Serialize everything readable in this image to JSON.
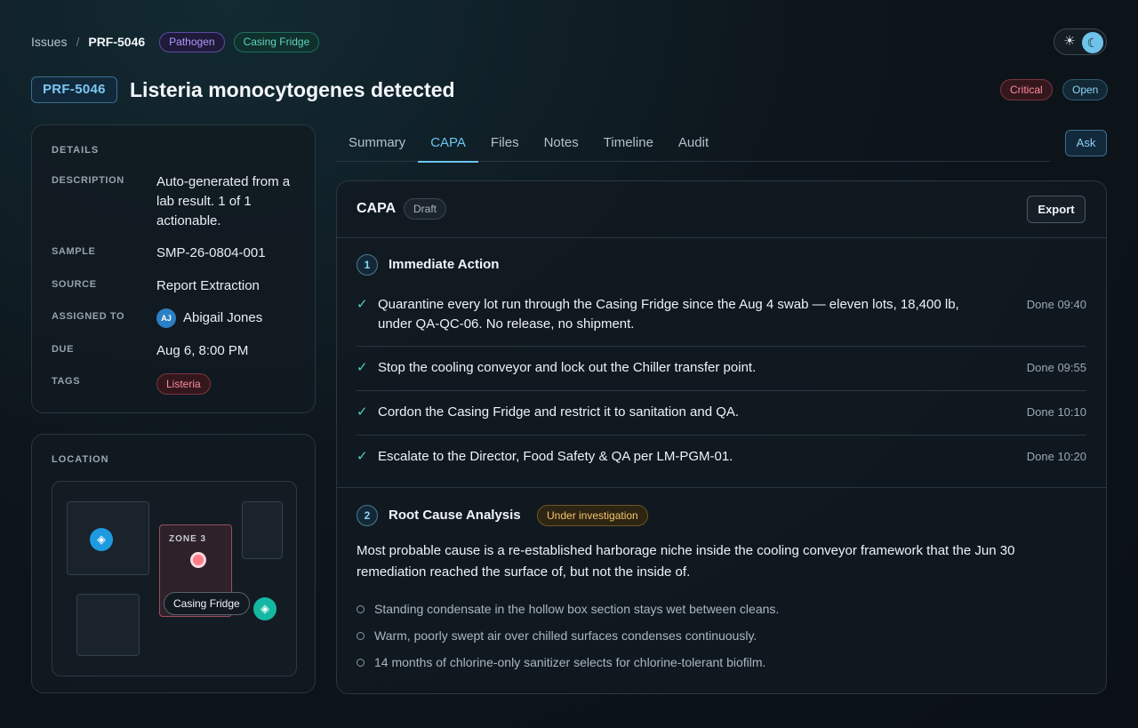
{
  "breadcrumb": {
    "root": "Issues",
    "separator": "/",
    "current": "PRF-5046"
  },
  "header_tags": [
    "Pathogen",
    "Casing Fridge"
  ],
  "theme_toggle": {
    "light_icon": "sun-icon",
    "dark_icon": "moon-icon",
    "active": "dark"
  },
  "issue": {
    "id": "PRF-5046",
    "title": "Listeria monocytogenes detected",
    "severity": "Critical",
    "status": "Open"
  },
  "details": {
    "heading": "DETAILS",
    "rows": [
      {
        "label": "DESCRIPTION",
        "value": "Auto-generated from a lab result. 1 of 1 actionable."
      },
      {
        "label": "SAMPLE",
        "value": "SMP-26-0804-001"
      },
      {
        "label": "SOURCE",
        "value": "Report Extraction"
      },
      {
        "label": "ASSIGNED TO",
        "value": "Abigail Jones",
        "initials": "AJ"
      },
      {
        "label": "DUE",
        "value": "Aug 6, 8:00 PM"
      },
      {
        "label": "TAGS",
        "value": "Listeria"
      }
    ]
  },
  "location": {
    "heading": "LOCATION",
    "zone_label": "ZONE 3",
    "tooltip": "Casing Fridge"
  },
  "tabs": [
    "Summary",
    "CAPA",
    "Files",
    "Notes",
    "Timeline",
    "Audit"
  ],
  "active_tab": "CAPA",
  "ask_label": "Ask",
  "capa": {
    "title": "CAPA",
    "status": "Draft",
    "export_label": "Export",
    "immediate": {
      "number": "1",
      "title": "Immediate Action",
      "actions": [
        {
          "text": "Quarantine every lot run through the Casing Fridge since the Aug 4 swab — eleven lots, 18,400 lb, under QA-QC-06. No release, no shipment.",
          "time": "Done 09:40"
        },
        {
          "text": "Stop the cooling conveyor and lock out the Chiller transfer point.",
          "time": "Done 09:55"
        },
        {
          "text": "Cordon the Casing Fridge and restrict it to sanitation and QA.",
          "time": "Done 10:10"
        },
        {
          "text": "Escalate to the Director, Food Safety & QA per LM-PGM-01.",
          "time": "Done 10:20"
        }
      ]
    },
    "rca": {
      "number": "2",
      "title": "Root Cause Analysis",
      "status": "Under investigation",
      "text": "Most probable cause is a re-established harborage niche inside the cooling conveyor framework that the Jun 30 remediation reached the surface of, but not the inside of.",
      "bullets": [
        "Standing condensate in the hollow box section stays wet between cleans.",
        "Warm, poorly swept air over chilled surfaces condenses continuously.",
        "14 months of chlorine-only sanitizer selects for chlorine-tolerant biofilm."
      ]
    }
  }
}
